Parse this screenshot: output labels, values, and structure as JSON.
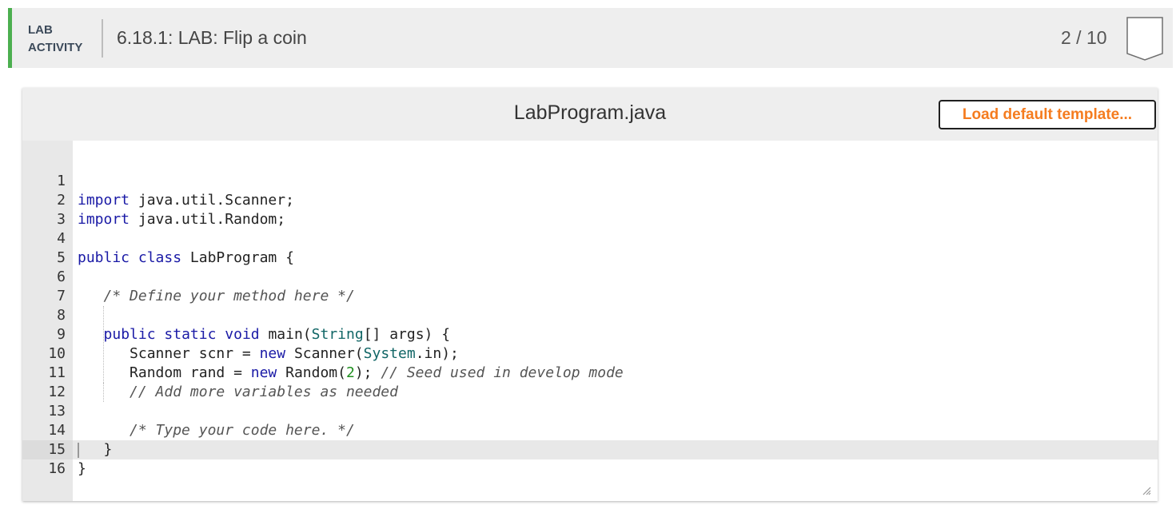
{
  "header": {
    "tag_line1": "LAB",
    "tag_line2": "ACTIVITY",
    "title": "6.18.1: LAB: Flip a coin",
    "score": "2 / 10",
    "accent_color": "#4caf50"
  },
  "editor": {
    "file_name": "LabProgram.java",
    "load_button": "Load default template...",
    "load_button_color": "#f57c1f",
    "active_line": "16",
    "lines": [
      {
        "n": "1"
      },
      {
        "n": "2"
      },
      {
        "n": "3"
      },
      {
        "n": "4"
      },
      {
        "n": "5"
      },
      {
        "n": "6"
      },
      {
        "n": "7"
      },
      {
        "n": "8"
      },
      {
        "n": "9"
      },
      {
        "n": "10"
      },
      {
        "n": "11"
      },
      {
        "n": "12"
      },
      {
        "n": "13"
      },
      {
        "n": "14"
      },
      {
        "n": "15"
      },
      {
        "n": "16"
      }
    ],
    "tokens": {
      "import": "import",
      "pkg_scanner": " java.util.Scanner;",
      "pkg_random": " java.util.Random;",
      "public": "public",
      "class": "class",
      "class_name": " LabProgram {",
      "comment_define": "/* Define your method here */",
      "static": "static",
      "void": "void",
      "main_sig": " main(",
      "String": "String",
      "args": "[] args) {",
      "scanner_decl": "Scanner scnr = ",
      "new": "new",
      "scanner_ctor": " Scanner(",
      "System": "System",
      "system_in": ".in);",
      "random_decl": "Random rand = ",
      "random_ctor": " Random(",
      "seed_num": "2",
      "random_close": "); ",
      "comment_seed": "// Seed used in develop mode",
      "comment_vars": "// Add more variables as needed",
      "comment_type": "/* Type your code here. */",
      "close_brace": "}"
    }
  }
}
